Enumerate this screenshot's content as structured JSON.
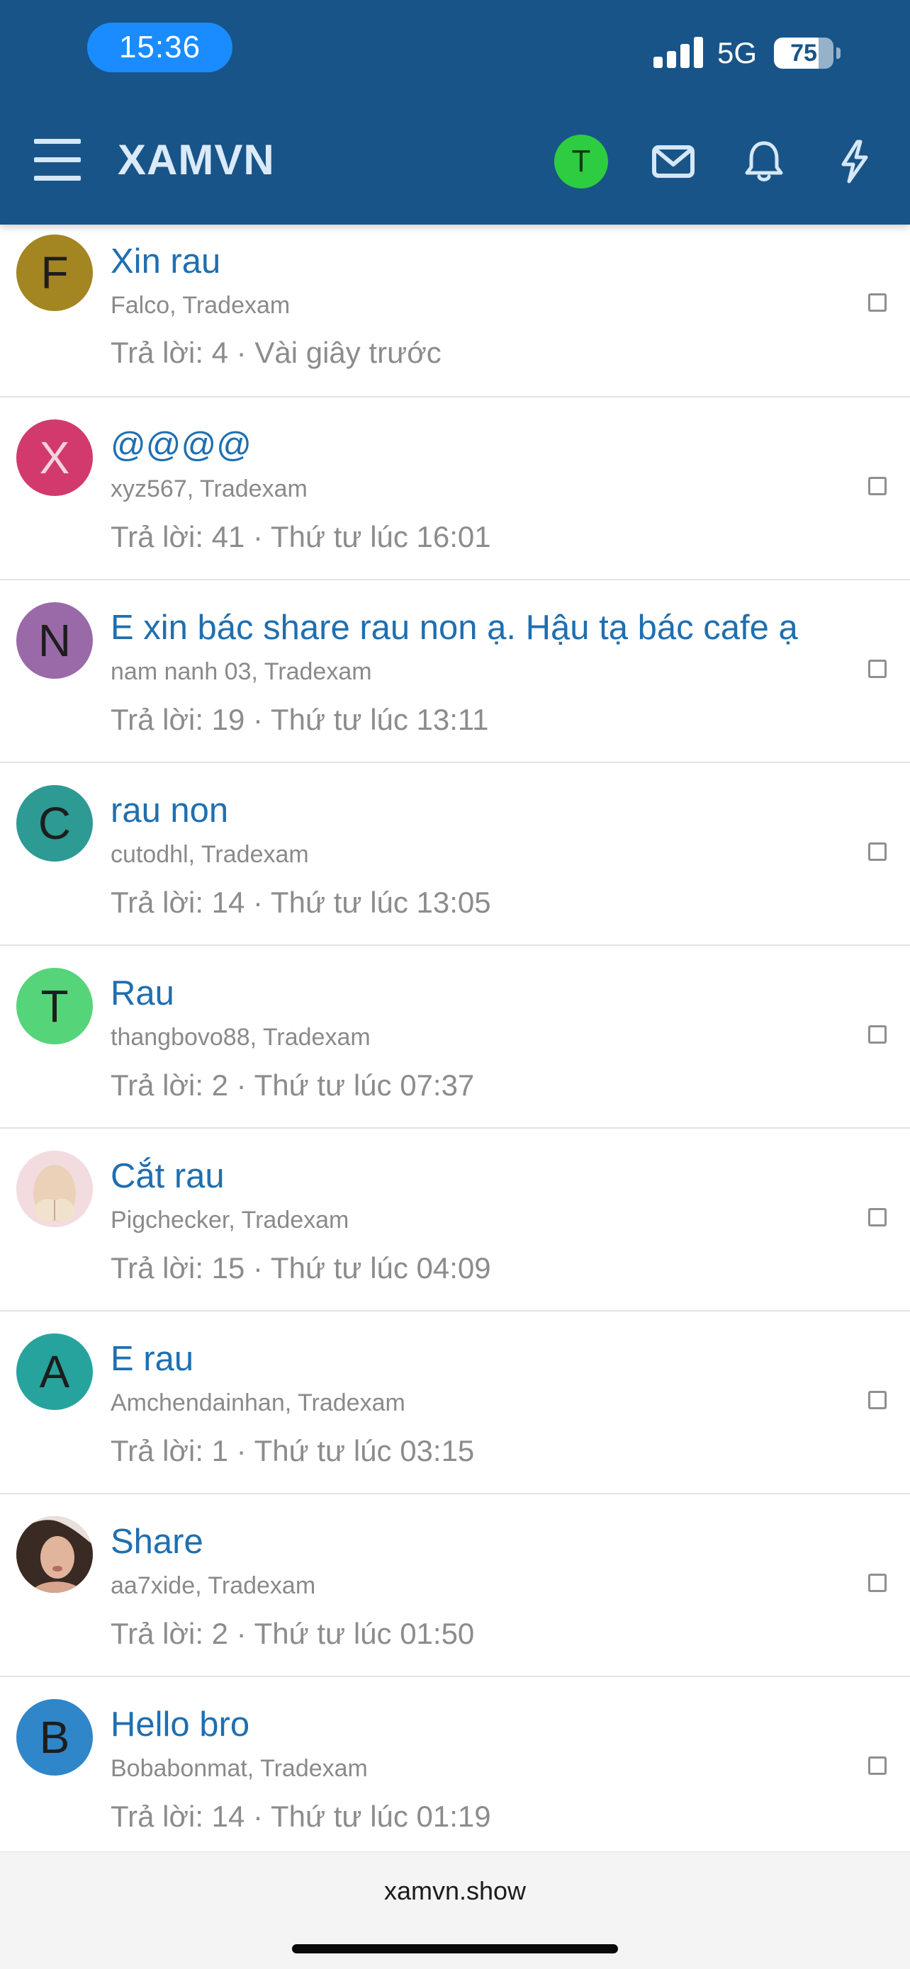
{
  "status_bar": {
    "time": "15:36",
    "network": "5G",
    "battery": "75",
    "battery_level_percent": 75,
    "signal_bars": 4
  },
  "nav": {
    "logo": "XAMVN",
    "user_initial": "T",
    "icons": [
      "menu-icon",
      "envelope-icon",
      "bell-icon",
      "lightning-icon"
    ]
  },
  "threads": [
    {
      "title": "Xin rau",
      "meta": "Falco, Tradexam",
      "stats": "Trả lời: 4 · Vài giây trước",
      "avatar_letter": "F",
      "avatar_color": "#a38521"
    },
    {
      "title": "@@@@",
      "meta": "xyz567, Tradexam",
      "stats": "Trả lời: 41 · Thứ tư lúc 16:01",
      "avatar_letter": "X",
      "avatar_color": "#d23a6e"
    },
    {
      "title": "E xin bác share rau non ạ. Hậu tạ bác cafe ạ",
      "meta": "nam nanh 03, Tradexam",
      "stats": "Trả lời: 19 · Thứ tư lúc 13:11",
      "avatar_letter": "N",
      "avatar_color": "#9a6aa8"
    },
    {
      "title": "rau non",
      "meta": "cutodhl, Tradexam",
      "stats": "Trả lời: 14 · Thứ tư lúc 13:05",
      "avatar_letter": "C",
      "avatar_color": "#2e9a94"
    },
    {
      "title": "Rau",
      "meta": "thangbovo88, Tradexam",
      "stats": "Trả lời: 2 · Thứ tư lúc 07:37",
      "avatar_letter": "T",
      "avatar_color": "#56d47a"
    },
    {
      "title": "Cắt rau",
      "meta": "Pigchecker, Tradexam",
      "stats": "Trả lời: 15 · Thứ tư lúc 04:09",
      "avatar_letter": "",
      "avatar_color": "#f3dcdf"
    },
    {
      "title": "E rau",
      "meta": "Amchendainhan, Tradexam",
      "stats": "Trả lời: 1 · Thứ tư lúc 03:15",
      "avatar_letter": "A",
      "avatar_color": "#27a39e"
    },
    {
      "title": "Share",
      "meta": "aa7xide, Tradexam",
      "stats": "Trả lời: 2 · Thứ tư lúc 01:50",
      "avatar_letter": "",
      "avatar_color": "#8a5a4a"
    },
    {
      "title": "Hello bro",
      "meta": "Bobabonmat, Tradexam",
      "stats": "Trả lời: 14 · Thứ tư lúc 01:19",
      "avatar_letter": "B",
      "avatar_color": "#2f86c9"
    }
  ],
  "browser": {
    "url": "xamvn.show"
  },
  "colors": {
    "header_bg": "#185488",
    "title_link": "#1f6fb0",
    "meta_text": "#8a8a8a"
  }
}
